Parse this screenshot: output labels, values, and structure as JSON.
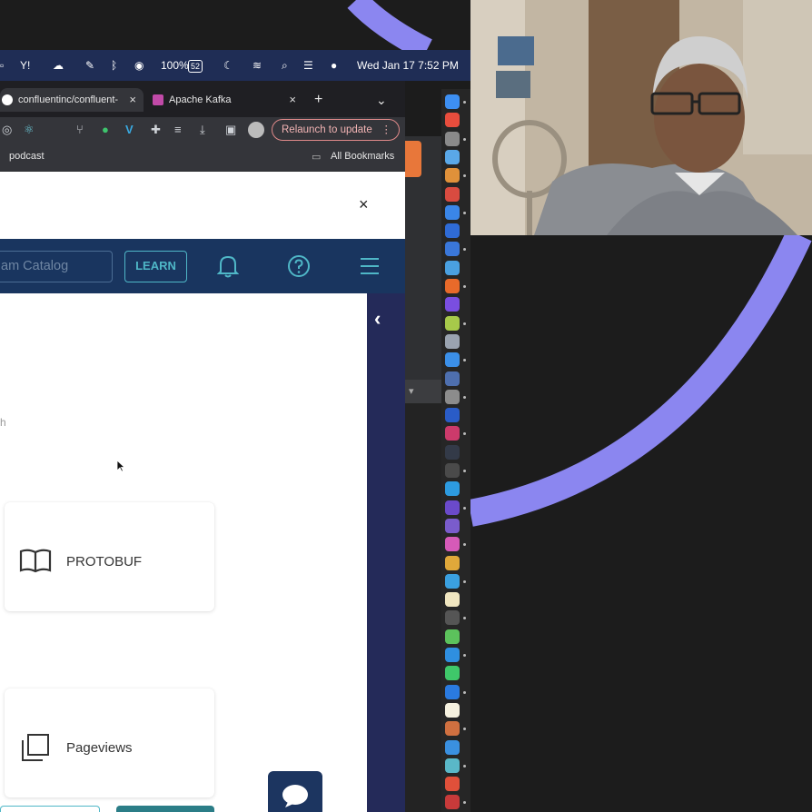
{
  "menubar": {
    "battery": "100%",
    "battery_level": "52",
    "datetime": "Wed Jan 17  7:52 PM"
  },
  "tabs": [
    {
      "label": "confluentinc/confluent-",
      "close": "×",
      "active": true
    },
    {
      "label": "Apache Kafka",
      "close": "×",
      "active": false
    }
  ],
  "new_tab": "+",
  "tab_menu": "⌄",
  "toolbar": {
    "relaunch_label": "Relaunch to update",
    "relaunch_more": "⋮"
  },
  "bookmarks": {
    "podcast": "podcast",
    "all": "All Bookmarks"
  },
  "banner": {
    "close": "×"
  },
  "navbar": {
    "search_placeholder": "am Catalog",
    "learn_label": "LEARN"
  },
  "content": {
    "fragment_text": "h",
    "cards": [
      {
        "label": "PROTOBUF",
        "icon": "book-icon"
      },
      {
        "label": "Pageviews",
        "icon": "layers-icon"
      }
    ]
  },
  "side_panel": {
    "collapse": "‹"
  },
  "colors": {
    "accent_teal": "#4fb7c7",
    "navbar": "#19355f",
    "rail": "#242a59",
    "arc": "#8b86f0"
  }
}
